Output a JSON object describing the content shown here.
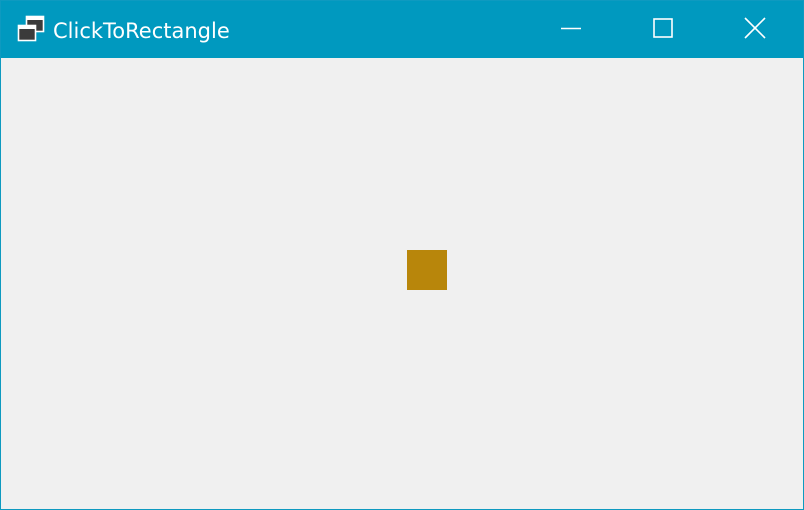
{
  "window": {
    "title": "ClickToRectangle",
    "icon": "app-windows-icon",
    "buttons": {
      "minimize_icon": "minimize-icon",
      "maximize_icon": "maximize-icon",
      "close_icon": "close-icon"
    },
    "colors": {
      "titlebar": "#0099bf",
      "client_background": "#f0f0f0"
    }
  },
  "canvas": {
    "shape": "rectangle",
    "rectangle_color": "#b8860b"
  }
}
